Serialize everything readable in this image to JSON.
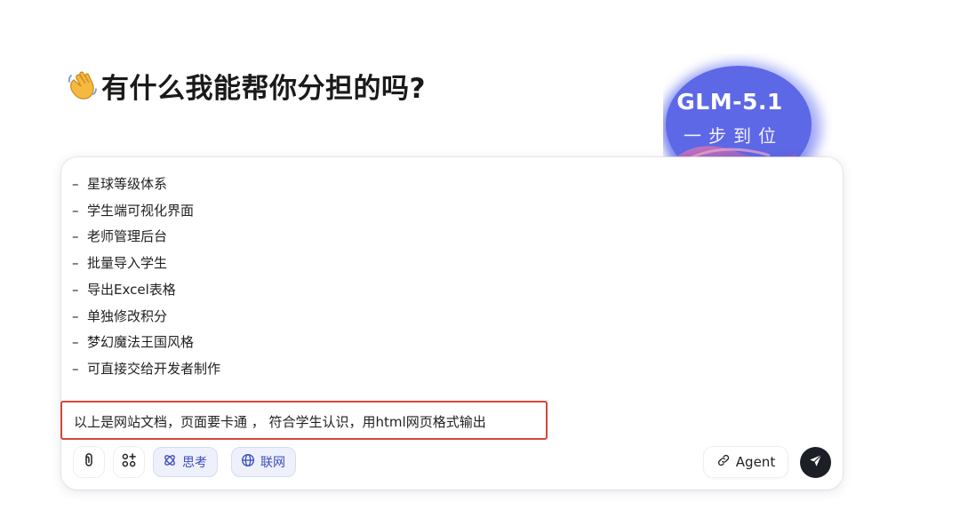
{
  "header": {
    "wave_icon": "waving-hand-icon",
    "title": "有什么我能帮你分担的吗?"
  },
  "promo": {
    "title": "GLM-5.1",
    "subtitle": "一步到位"
  },
  "editor": {
    "list_items": [
      "星球等级体系",
      "学生端可视化界面",
      "老师管理后台",
      "批量导入学生",
      "导出Excel表格",
      "单独修改积分",
      "梦幻魔法王国风格",
      "可直接交给开发者制作"
    ],
    "bullet": "–",
    "prompt": "以上是网站文档，页面要卡通 ， 符合学生认识，用html网页格式输出",
    "highlight_color": "#d6463a"
  },
  "toolbar": {
    "attach_icon": "paperclip-icon",
    "apps_icon": "apps-add-icon",
    "think_label": "思考",
    "think_icon": "reasoning-icon",
    "web_label": "联网",
    "web_icon": "globe-icon",
    "agent_label": "Agent",
    "agent_icon": "link-icon",
    "send_icon": "send-icon",
    "toggle_color": "#3e4fb8"
  }
}
